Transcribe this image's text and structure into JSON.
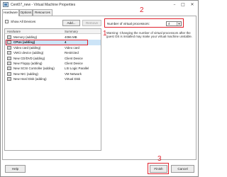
{
  "window": {
    "title": "Cent07_new - Virtual Machine Properties",
    "controls": {
      "minimize": "–",
      "maximize": "□",
      "close": "✕"
    }
  },
  "tabs": [
    {
      "label": "Hardware",
      "active": true
    },
    {
      "label": "Options",
      "active": false
    },
    {
      "label": "Resources",
      "active": false
    }
  ],
  "hardware": {
    "show_all_devices_label": "Show All Devices",
    "show_all_devices_checked": false,
    "add_label": "Add...",
    "remove_label": "Remove",
    "columns": [
      "Hardware",
      "Summary"
    ],
    "rows": [
      {
        "name": "Memory (adding)",
        "summary": "4096 MB",
        "icon": "memory-icon",
        "selected": false
      },
      {
        "name": "CPUs (adding)",
        "summary": "4",
        "icon": "cpu-icon",
        "selected": true
      },
      {
        "name": "Video card (adding)",
        "summary": "Video card",
        "icon": "video-card-icon",
        "selected": false
      },
      {
        "name": "VMCI device (adding)",
        "summary": "Restricted",
        "icon": "vmci-device-icon",
        "selected": false
      },
      {
        "name": "New CD/DVD (adding)",
        "summary": "Client Device",
        "icon": "cd-dvd-icon",
        "selected": false
      },
      {
        "name": "New Floppy (adding)",
        "summary": "Client Device",
        "icon": "floppy-icon",
        "selected": false
      },
      {
        "name": "New SCSI Controller (adding)",
        "summary": "LSI Logic Parallel",
        "icon": "scsi-controller-icon",
        "selected": false
      },
      {
        "name": "New NIC (adding)",
        "summary": "VM Network",
        "icon": "nic-icon",
        "selected": false
      },
      {
        "name": "New Hard Disk (adding)",
        "summary": "Virtual Disk",
        "icon": "hard-disk-icon",
        "selected": false
      }
    ]
  },
  "cpu_settings": {
    "label": "Number of virtual processors:",
    "value": "4",
    "warning": "Warning: Changing the number of virtual processors after the guest OS is installed may make your virtual machine unstable."
  },
  "annotations": {
    "marker1": "1",
    "marker2": "2",
    "marker3": "3",
    "color": "#e0232e"
  },
  "footer": {
    "help_label": "Help",
    "finish_label": "Finish",
    "cancel_label": "Cancel"
  }
}
